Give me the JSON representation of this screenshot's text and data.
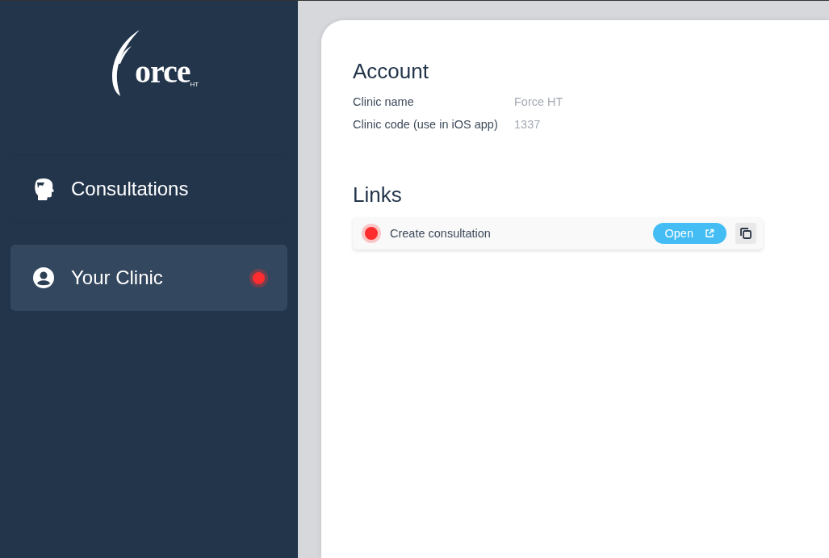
{
  "logo": {
    "text": "orce",
    "suffix": "HT"
  },
  "sidebar": {
    "items": [
      {
        "label": "Consultations",
        "kind": "consultations",
        "selected": false,
        "alert": false
      },
      {
        "label": "Your Clinic",
        "kind": "clinic",
        "selected": true,
        "alert": true
      }
    ]
  },
  "account": {
    "title": "Account",
    "fields": [
      {
        "label": "Clinic name",
        "value": "Force HT"
      },
      {
        "label": "Clinic code (use in iOS app)",
        "value": "1337"
      }
    ]
  },
  "links": {
    "title": "Links",
    "items": [
      {
        "label": "Create consultation",
        "color": "#ff2d2d",
        "button": "Open"
      }
    ]
  }
}
